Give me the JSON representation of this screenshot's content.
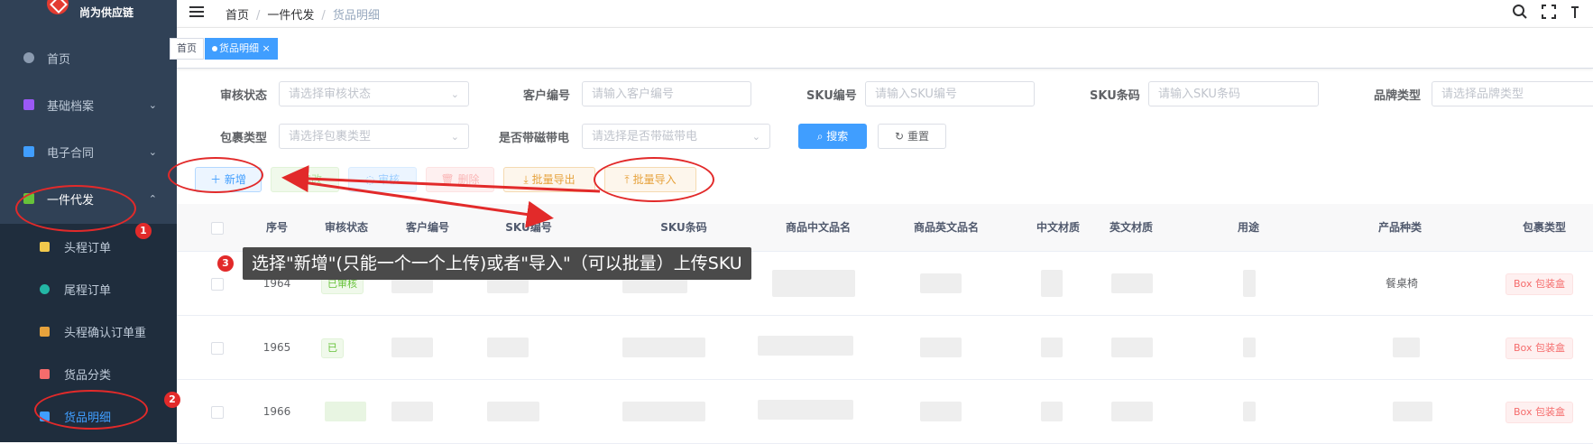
{
  "app": {
    "logo_text": "尚为供应链"
  },
  "sidebar": {
    "items": [
      {
        "label": "首页",
        "color": "#8b9bb0",
        "chevron": ""
      },
      {
        "label": "基础档案",
        "color": "#9b59f6",
        "chevron": "⌄"
      },
      {
        "label": "电子合同",
        "color": "#409eff",
        "chevron": "⌄"
      },
      {
        "label": "一件代发",
        "color": "#67c23a",
        "chevron": "⌃"
      }
    ],
    "sub_items": [
      {
        "label": "头程订单",
        "color": "#f2c94c"
      },
      {
        "label": "尾程订单",
        "color": "#23b7a5"
      },
      {
        "label": "头程确认订单重",
        "color": "#e6a23c"
      },
      {
        "label": "货品分类",
        "color": "#f56c6c"
      },
      {
        "label": "货品明细",
        "color": "#409eff"
      }
    ]
  },
  "header": {
    "breadcrumb": [
      "首页",
      "一件代发",
      "货品明细"
    ],
    "sep": "/"
  },
  "tags": [
    {
      "label": "首页"
    },
    {
      "label": "货品明细",
      "close": "×"
    }
  ],
  "filters": {
    "row1": [
      {
        "label": "审核状态",
        "placeholder": "请选择审核状态",
        "select": true
      },
      {
        "label": "客户编号",
        "placeholder": "请输入客户编号",
        "select": false
      },
      {
        "label": "SKU编号",
        "placeholder": "请输入SKU编号",
        "select": false
      },
      {
        "label": "SKU条码",
        "placeholder": "请输入SKU条码",
        "select": false
      },
      {
        "label": "品牌类型",
        "placeholder": "请选择品牌类型",
        "select": true
      }
    ],
    "row2": [
      {
        "label": "包裹类型",
        "placeholder": "请选择包裹类型",
        "select": true
      },
      {
        "label": "是否带磁带电",
        "placeholder": "请选择是否带磁带电",
        "select": true
      }
    ],
    "search_label": "搜索",
    "reset_label": "重置"
  },
  "toolbar": {
    "add": "新增",
    "edit": "修改",
    "audit": "审核",
    "delete": "删除",
    "export": "批量导出",
    "import": "批量导入"
  },
  "table": {
    "columns": [
      "序号",
      "审核状态",
      "客户编号",
      "SKU编号",
      "SKU条码",
      "商品中文品名",
      "商品英文品名",
      "中文材质",
      "英文材质",
      "用途",
      "产品种类",
      "包裹类型"
    ],
    "rows": [
      {
        "index": "1964",
        "status": "已审核",
        "category": "餐桌椅",
        "package": "Box 包装盒"
      },
      {
        "index": "1965",
        "status": "已",
        "category": "",
        "package": "Box 包装盒"
      },
      {
        "index": "1966",
        "status": "",
        "category": "",
        "package": "Box 包装盒"
      }
    ]
  },
  "annotations": {
    "num1": "1",
    "num2": "2",
    "num3": "3",
    "callout": "选择\"新增\"(只能一个一个上传)或者\"导入\"（可以批量）上传SKU",
    "color": "#e22a2a"
  }
}
